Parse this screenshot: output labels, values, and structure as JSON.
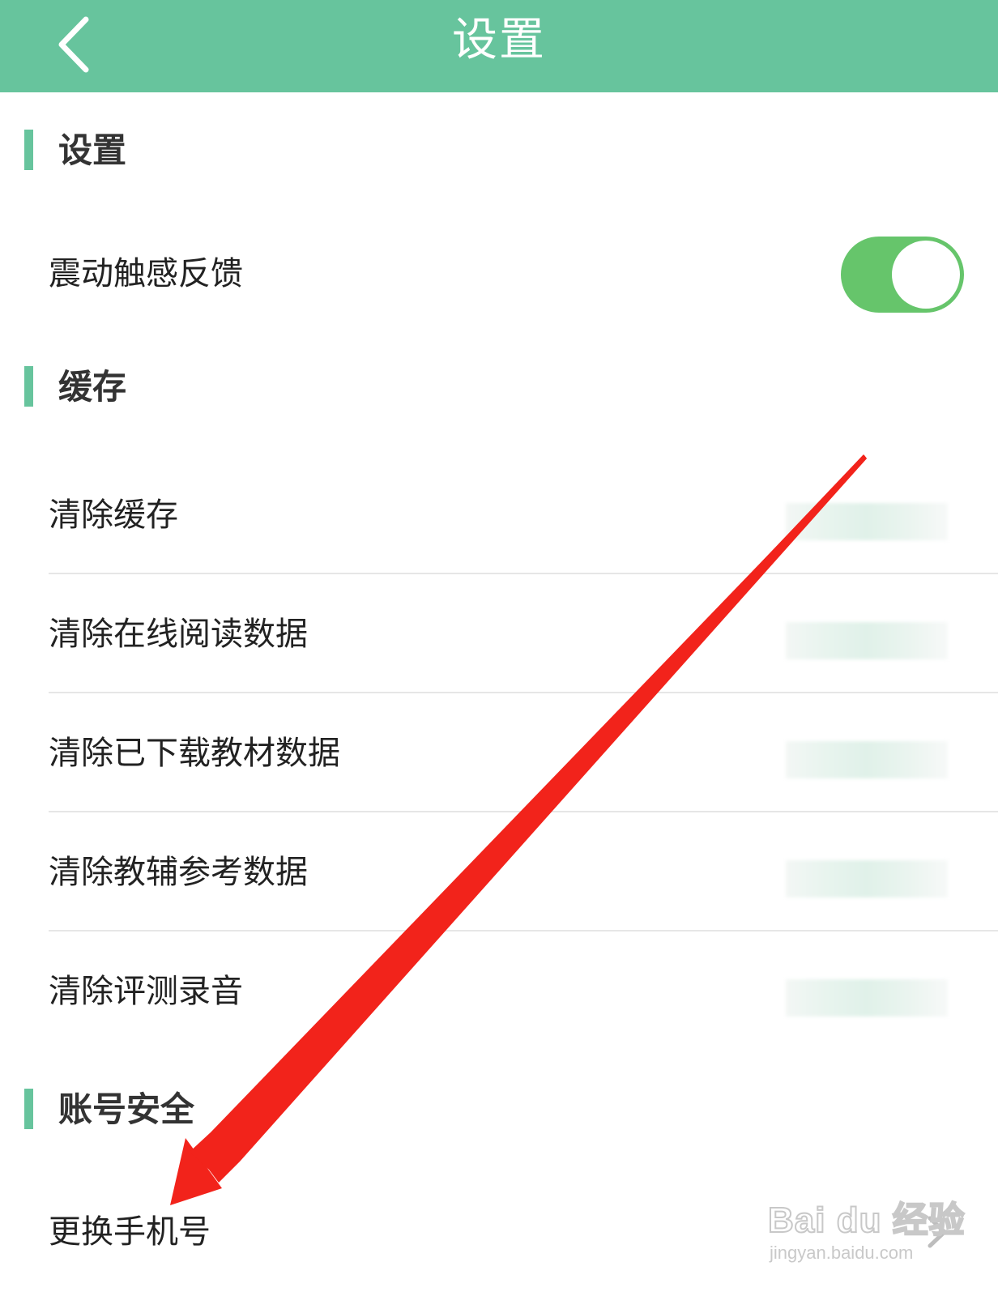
{
  "header": {
    "title": "设置",
    "back_icon": "chevron-left-icon",
    "background_color": "#67c49d"
  },
  "sections": [
    {
      "title": "设置",
      "rows": [
        {
          "label": "震动触感反馈",
          "control": "toggle",
          "toggle_on": true
        }
      ]
    },
    {
      "title": "缓存",
      "rows": [
        {
          "label": "清除缓存",
          "value": "(blurred)"
        },
        {
          "label": "清除在线阅读数据",
          "value": "(blurred)"
        },
        {
          "label": "清除已下载教材数据",
          "value": "(blurred)"
        },
        {
          "label": "清除教辅参考数据",
          "value": "(blurred)"
        },
        {
          "label": "清除评测录音",
          "value": "(blurred)"
        }
      ]
    },
    {
      "title": "账号安全",
      "rows": [
        {
          "label": "更换手机号",
          "trailing_icon": "chevron-right-icon"
        }
      ]
    }
  ],
  "watermark": {
    "logo_text": "Bai du 经验",
    "url": "jingyan.baidu.com"
  },
  "colors": {
    "accent": "#67c49d",
    "toggle_on": "#66c56b",
    "annotation_arrow": "#f2231b"
  }
}
